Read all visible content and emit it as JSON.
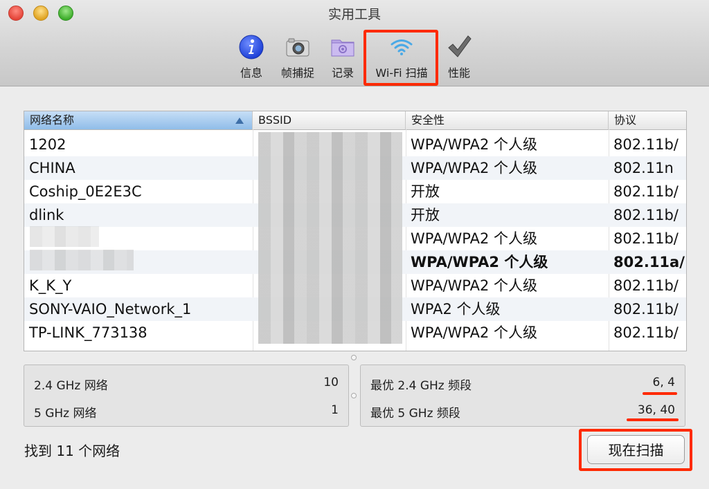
{
  "window": {
    "title": "实用工具"
  },
  "toolbar": {
    "items": [
      {
        "label": "信息",
        "icon": "info-icon"
      },
      {
        "label": "帧捕捉",
        "icon": "camera-icon"
      },
      {
        "label": "记录",
        "icon": "log-folder-icon"
      },
      {
        "label": "Wi-Fi 扫描",
        "icon": "wifi-icon",
        "selected": true
      },
      {
        "label": "性能",
        "icon": "checkmark-icon"
      }
    ]
  },
  "table": {
    "columns": [
      "网络名称",
      "BSSID",
      "安全性",
      "协议"
    ],
    "sorted_column": "网络名称",
    "rows": [
      {
        "name": "1202",
        "security": "WPA/WPA2 个人级",
        "protocol": "802.11b/"
      },
      {
        "name": "CHINA",
        "security": "WPA/WPA2 个人级",
        "protocol": "802.11n"
      },
      {
        "name": "Coship_0E2E3C",
        "security": "开放",
        "protocol": "802.11b/"
      },
      {
        "name": "dlink",
        "security": "开放",
        "protocol": "802.11b/"
      },
      {
        "name": "",
        "security": "WPA/WPA2 个人级",
        "protocol": "802.11b/"
      },
      {
        "name": "",
        "security": "WPA/WPA2 个人级",
        "protocol": "802.11a/",
        "bold": true
      },
      {
        "name": "K_K_Y",
        "security": "WPA/WPA2 个人级",
        "protocol": "802.11b/"
      },
      {
        "name": "SONY-VAIO_Network_1",
        "security": "WPA2 个人级",
        "protocol": "802.11b/"
      },
      {
        "name": "TP-LINK_773138",
        "security": "WPA/WPA2 个人级",
        "protocol": "802.11b/"
      }
    ]
  },
  "stats": {
    "ghz24_label": "2.4 GHz 网络",
    "ghz24_count": "10",
    "ghz5_label": "5 GHz 网络",
    "ghz5_count": "1",
    "best24_label": "最优 2.4 GHz 频段",
    "best24_value": "6, 4",
    "best5_label": "最优 5 GHz 频段",
    "best5_value": "36, 40"
  },
  "footer": {
    "found_text": "找到 11 个网络",
    "scan_button": "现在扫描"
  },
  "colors": {
    "highlight": "#ff2a00",
    "sort_header": "#90bde9"
  }
}
